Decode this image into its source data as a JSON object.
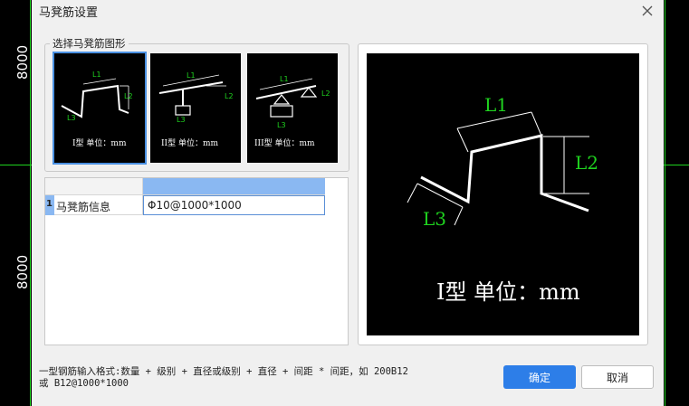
{
  "background": {
    "dimension_top": "8000",
    "dimension_bottom": "8000",
    "grid_line_color": "#1fd31f"
  },
  "dialog": {
    "title": "马凳筋设置",
    "close_icon": "close-icon"
  },
  "selector": {
    "group_label": "选择马凳筋图形",
    "options": [
      {
        "type_label": "I型 单位：mm",
        "selected": true,
        "dims": [
          "L1",
          "L2",
          "L3"
        ]
      },
      {
        "type_label": "II型 单位：mm",
        "selected": false,
        "dims": [
          "L1",
          "L2",
          "L3"
        ]
      },
      {
        "type_label": "III型 单位：mm",
        "selected": false,
        "dims": [
          "L1",
          "L2",
          "L3"
        ]
      }
    ]
  },
  "table": {
    "row_number": "1",
    "row_label": "马凳筋信息",
    "row_value": "Φ10@1000*1000"
  },
  "preview": {
    "dims": [
      "L1",
      "L2",
      "L3"
    ],
    "caption": "I型 单位：mm"
  },
  "footer": {
    "hint_line1": "一型钢筋输入格式:数量 + 级别 + 直径或级别 + 直径 + 间距 * 间距，如 200B12",
    "hint_line2": "或 B12@1000*1000",
    "ok_label": "确定",
    "cancel_label": "取消"
  },
  "colors": {
    "accent": "#2d7ee8",
    "dimension_text": "#1fd31f",
    "selected_header": "#8ab8f2"
  }
}
